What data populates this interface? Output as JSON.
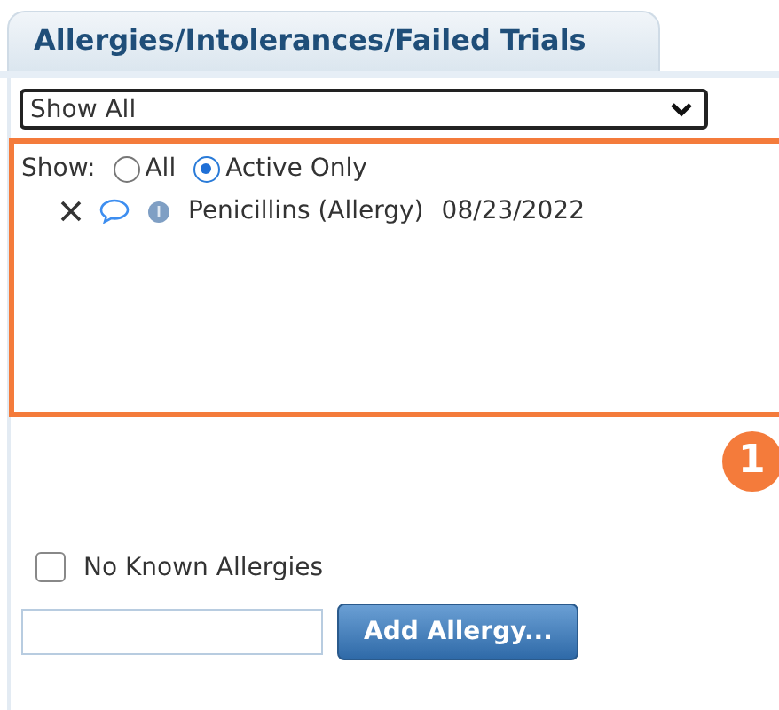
{
  "tab": {
    "label": "Allergies/Intolerances/Failed Trials",
    "selected": true
  },
  "filter": {
    "value": "Show All"
  },
  "show": {
    "label": "Show:",
    "options": [
      {
        "label": "All",
        "selected": false
      },
      {
        "label": "Active Only",
        "selected": true
      }
    ]
  },
  "allergies": [
    {
      "name": "Penicillins (Allergy)",
      "date": "08/23/2022"
    }
  ],
  "callout": {
    "number": "1"
  },
  "no_known_allergies": {
    "label": "No Known Allergies",
    "checked": false
  },
  "add_button": {
    "label": "Add Allergy..."
  }
}
